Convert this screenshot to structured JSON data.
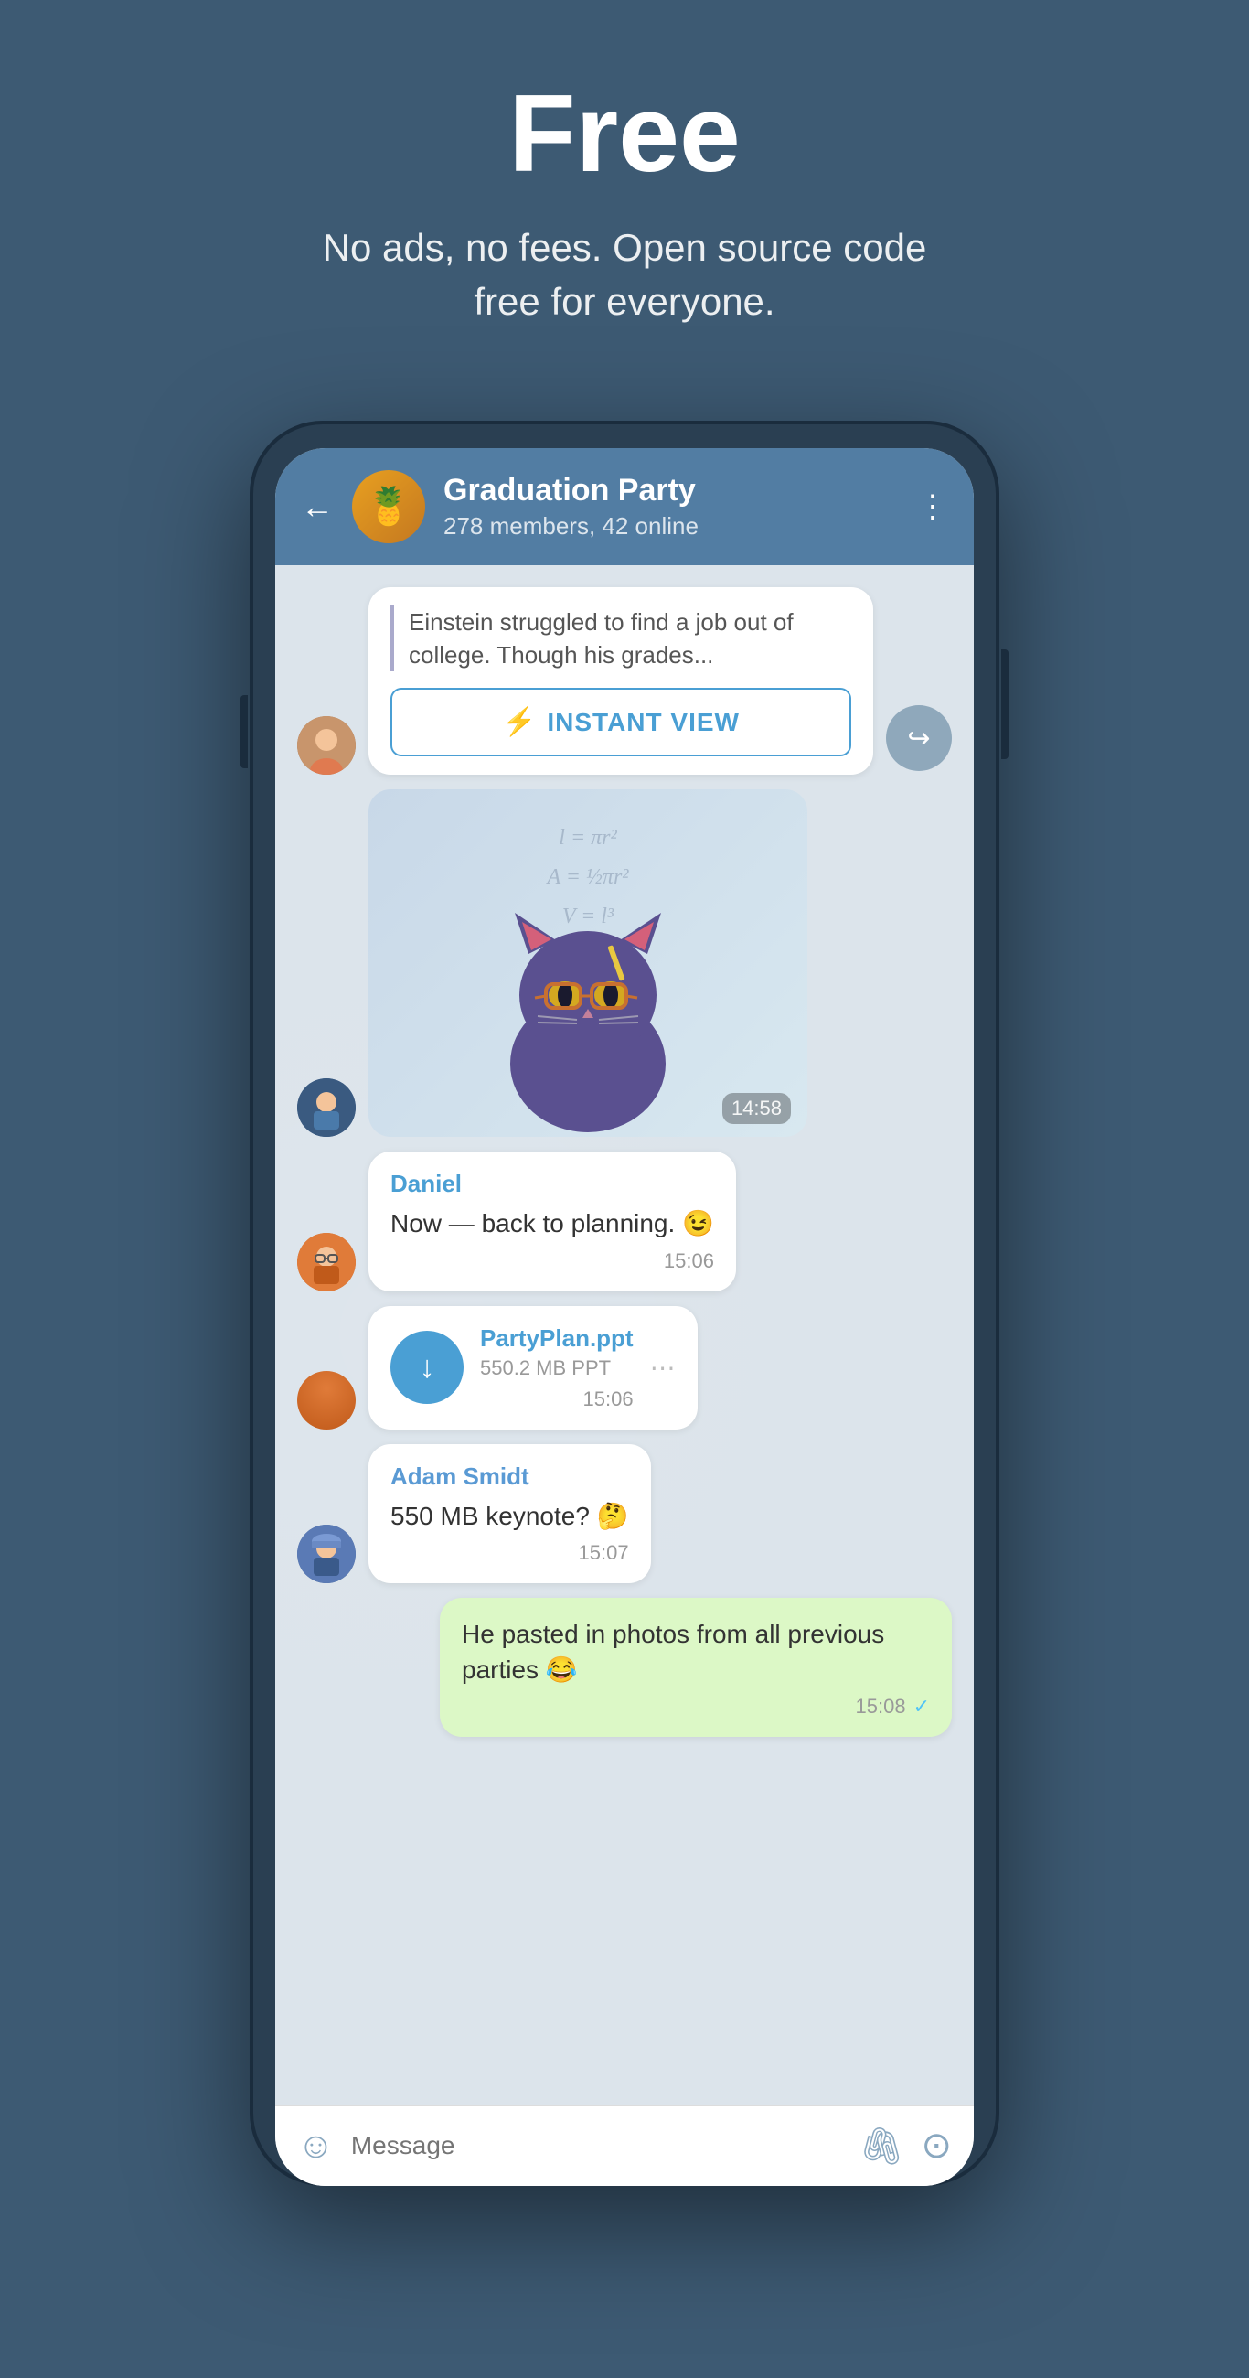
{
  "hero": {
    "title": "Free",
    "subtitle": "No ads, no fees. Open source code free for everyone."
  },
  "chat": {
    "back_label": "←",
    "group_name": "Graduation Party",
    "group_status": "278 members, 42 online",
    "more_icon": "⋮"
  },
  "messages": [
    {
      "id": "iv-msg",
      "type": "iv",
      "preview": "Einstein struggled to find a job out of college. Though his grades...",
      "iv_button_label": "INSTANT VIEW",
      "avatar_class": "av-girl"
    },
    {
      "id": "sticker-msg",
      "type": "sticker",
      "time": "14:58",
      "avatar_class": "av-boy-hoodie"
    },
    {
      "id": "daniel-msg",
      "type": "text",
      "sender": "Daniel",
      "text": "Now — back to planning. 😉",
      "time": "15:06",
      "avatar_class": "av-guy-glasses"
    },
    {
      "id": "file-msg",
      "type": "file",
      "file_name": "PartyPlan.ppt",
      "file_size": "550.2 MB PPT",
      "time": "15:06",
      "avatar_class": "av-guy-glasses"
    },
    {
      "id": "adam-msg",
      "type": "text",
      "sender": "Adam Smidt",
      "text": "550 MB keynote? 🤔",
      "time": "15:07",
      "avatar_class": "av-hat-guy"
    },
    {
      "id": "my-msg",
      "type": "text",
      "text": "He pasted in photos from all previous parties 😂",
      "time": "15:08",
      "is_own": true
    }
  ],
  "input_bar": {
    "placeholder": "Message"
  },
  "icons": {
    "back": "←",
    "bolt": "⚡",
    "share": "↪",
    "download": "↓",
    "emoji": "☺",
    "attach": "🖇",
    "camera": "⊙",
    "check": "✓"
  }
}
